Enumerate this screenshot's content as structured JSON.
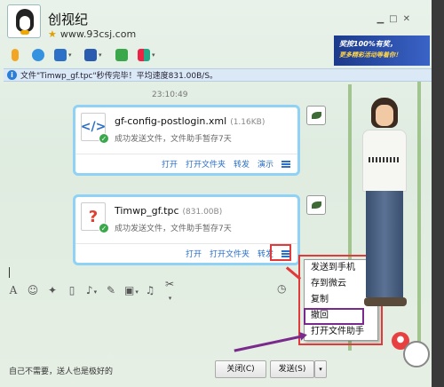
{
  "header": {
    "title": "创视纪",
    "url": "www.93csj.com"
  },
  "banner": {
    "line1": "奖按100%有奖，",
    "line2": "更多精彩活动等着你！"
  },
  "notice": {
    "text": "文件\"Timwp_gf.tpc\"秒传完毕！平均速度831.00B/S。"
  },
  "chat": {
    "time": "23:10:49",
    "files": [
      {
        "name": "gf-config-postlogin.xml",
        "size": "(1.16KB)",
        "status": "成功发送文件，文件助手暂存7天",
        "actions": [
          "打开",
          "打开文件夹",
          "转发",
          "演示"
        ]
      },
      {
        "name": "Timwp_gf.tpc",
        "size": "(831.00B)",
        "status": "成功发送文件，文件助手暂存7天",
        "actions": [
          "打开",
          "打开文件夹",
          "转发"
        ]
      }
    ]
  },
  "context_menu": {
    "items": [
      "发送到手机",
      "存到微云",
      "复制",
      "撤回",
      "打开文件助手"
    ]
  },
  "footer": {
    "slogan": "自己不需要，送人也是极好的",
    "close_label": "关闭(C)",
    "send_label": "发送(S)"
  },
  "colors": {
    "highlight_red": "#e23a3a",
    "highlight_purple": "#7a2a8c",
    "link_blue": "#2a6fc9",
    "card_border": "#8fd2f5"
  },
  "icons": {
    "toolbar": [
      "microphone-icon",
      "video-icon",
      "file-transfer-icon",
      "screen-share-icon",
      "add-contact-icon",
      "apps-icon"
    ],
    "edit_toolbar": [
      "font-icon",
      "emoji-icon",
      "magic-icon",
      "shake-icon",
      "voice-icon",
      "edit-icon",
      "image-icon",
      "music-icon",
      "screenshot-icon",
      "history-icon"
    ]
  }
}
